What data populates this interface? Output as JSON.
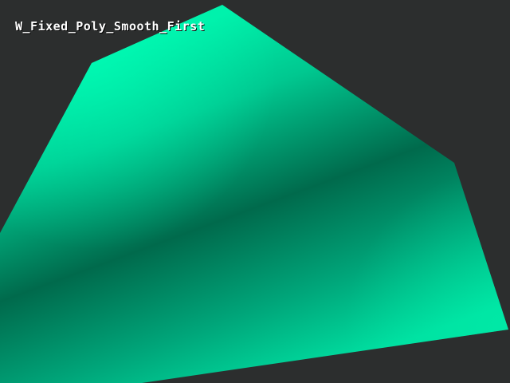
{
  "demo": {
    "title": "W_Fixed_Poly_Smooth_First"
  },
  "colors": {
    "background": "#2c2e2e",
    "polygon_bright": "#00eaa6",
    "polygon_mid": "#00a878",
    "polygon_dark": "#006448",
    "text": "#ffffff"
  }
}
